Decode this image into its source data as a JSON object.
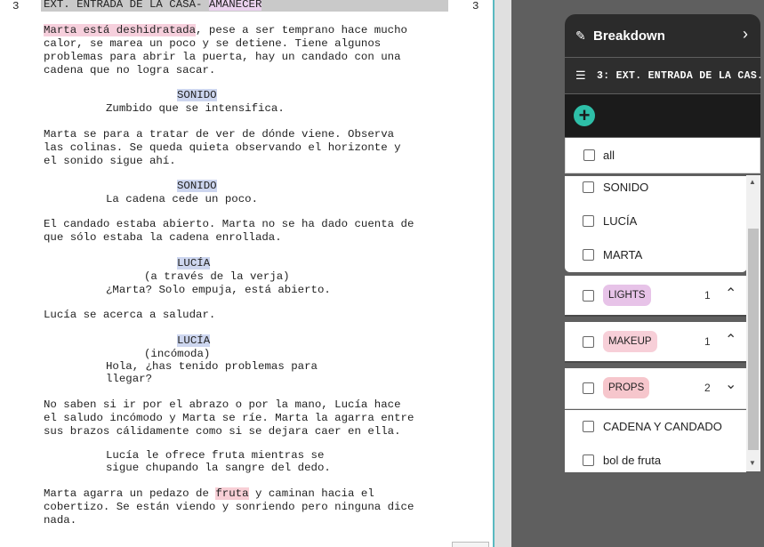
{
  "script": {
    "scene_number": "3",
    "heading": "EXT. ENTRADA DE LA CASA- ",
    "heading_time": "AMANECER",
    "p1_highlight": "Marta está deshidratada",
    "p1_rest": ", pese a ser temprano hace mucho",
    "p1_lines": [
      "calor, se marea un poco y se detiene. Tiene algunos",
      "problemas para abrir la puerta, hay un candado con una",
      "cadena que no logra sacar."
    ],
    "sound1_char": "SONIDO",
    "sound1_dialog": "Zumbido que se intensifica.",
    "p2_lines": [
      "Marta se para a tratar de ver de dónde viene. Observa",
      "las colinas. Se queda quieta observando el horizonte y",
      "el sonido sigue ahí."
    ],
    "sound2_char": "SONIDO",
    "sound2_dialog": "La cadena cede un poco.",
    "p3_lines": [
      "El candado estaba abierto. Marta no se ha dado cuenta de",
      "que sólo estaba la cadena enrollada."
    ],
    "lucia1_char": "LUCÍA",
    "lucia1_paren": "(a través de la verja)",
    "lucia1_dialog": "¿Marta? Solo empuja, está abierto.",
    "p4_line": "Lucía se acerca a saludar.",
    "lucia2_char": "LUCÍA",
    "lucia2_paren": "(incómoda)",
    "lucia2_dialog": [
      "Hola, ¿has tenido problemas para",
      "llegar?"
    ],
    "p5_lines": [
      "No saben si ir por el abrazo o por la mano, Lucía hace",
      "el saludo incómodo y Marta se ríe. Marta la agarra entre",
      "sus brazos cálidamente como si se dejara caer en ella."
    ],
    "p6_lines": [
      "Lucía le ofrece fruta mientras se",
      "sigue chupando la sangre del dedo."
    ],
    "p7_pre": "Marta agarra un pedazo de ",
    "p7_highlight": "fruta",
    "p7_post": " y caminan hacia el",
    "p7_lines": [
      "cobertizo. Se están viendo y sonriendo pero ninguna dice",
      "nada."
    ]
  },
  "panel": {
    "title": "Breakdown",
    "scene_label": "3: EXT. ENTRADA DE LA CAS...",
    "all_label": "all",
    "characters": [
      "SONIDO",
      "LUCÍA",
      "MARTA"
    ],
    "categories": [
      {
        "label": "LIGHTS",
        "count": "1",
        "caret": "^",
        "color": "#e7c3e8"
      },
      {
        "label": "MAKEUP",
        "count": "1",
        "caret": "^",
        "color": "#f7cfd8"
      },
      {
        "label": "PROPS",
        "count": "2",
        "caret": "v",
        "color": "#f6c6cc"
      }
    ],
    "props_items": [
      "CADENA Y CANDADO",
      "bol de fruta"
    ]
  }
}
